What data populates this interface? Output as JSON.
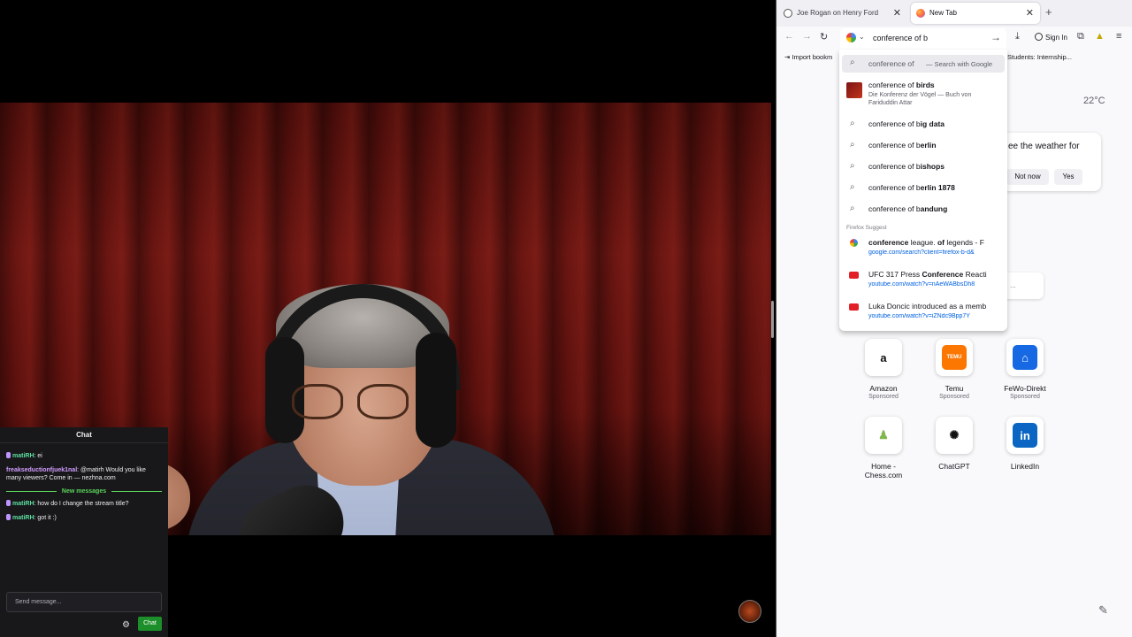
{
  "chat": {
    "title": "Chat",
    "messages": [
      {
        "user": "matiRH",
        "sep": ": ",
        "text": "ei",
        "color": "green"
      },
      {
        "user": "freakseductionfjuek1nal",
        "sep": ": ",
        "text": "@matirh Would you like many viewers? Come in — nezhna.com",
        "color": "purple"
      }
    ],
    "new_messages_label": "New messages",
    "messages_after": [
      {
        "user": "matiRH",
        "sep": ": ",
        "text": "how do I change the stream title?"
      },
      {
        "user": "matiRH",
        "sep": ": ",
        "text": "got it :)"
      }
    ],
    "input_placeholder": "Send message...",
    "send_label": "Chat"
  },
  "browser": {
    "tabs": [
      {
        "title": "Joe Rogan on Henry Ford",
        "active": false
      },
      {
        "title": "New Tab",
        "active": true
      }
    ],
    "new_tab_icon": "+",
    "urlbar": {
      "value": "conference of b",
      "engine_icon": "google-icon"
    },
    "signin_label": "Sign In",
    "bookmarks": [
      {
        "label": "Import bookm"
      },
      {
        "label": "Students: Internship..."
      }
    ],
    "suggestions": {
      "selected": {
        "text": "conference of",
        "action": "Search with Google"
      },
      "rich": {
        "prefix": "conference of ",
        "bold": "birds",
        "sub": "Die Konferenz der Vögel — Buch von Fariduddin Attar"
      },
      "searches": [
        {
          "prefix": "conference of b",
          "bold": "ig data"
        },
        {
          "prefix": "conference of b",
          "bold": "erlin"
        },
        {
          "prefix": "conference of b",
          "bold": "ishops"
        },
        {
          "prefix": "conference of b",
          "bold": "erlin 1878"
        },
        {
          "prefix": "conference of b",
          "bold": "andung"
        }
      ],
      "section_label": "Firefox Suggest",
      "history": [
        {
          "icon": "google-icon",
          "bold1": "conference",
          "mid1": " league. ",
          "bold2": "of",
          "rest": " legends - F",
          "url": "google.com/search?client=firefox-b-d&"
        },
        {
          "icon": "youtube-icon",
          "pre": "UFC 317 Press ",
          "bold1": "Conference",
          "rest": " Reacti",
          "url": "youtube.com/watch?v=nAeWABbsDh8"
        },
        {
          "icon": "youtube-icon",
          "pre": "Luka Doncic introduced as a memb",
          "url": "youtube.com/watch?v=iZNdc9Bpp7Y"
        }
      ]
    },
    "weather": {
      "temp": "22°C",
      "question": "ee the weather for",
      "no": "Not now",
      "yes": "Yes"
    },
    "hidden_card_text": "...",
    "shortcuts": [
      {
        "label": "Amazon",
        "sub": "Sponsored",
        "glyph": "a",
        "bg": "#ffffff",
        "fg": "#111111"
      },
      {
        "label": "Temu",
        "sub": "Sponsored",
        "glyph": "TEMU",
        "bg": "#fb7701",
        "fg": "#ffffff"
      },
      {
        "label": "FeWo-Direkt",
        "sub": "Sponsored",
        "glyph": "⌂",
        "bg": "#1668e3",
        "fg": "#ffffff"
      },
      {
        "label": "Home -\nChess.com",
        "sub": "",
        "glyph": "♟",
        "bg": "#ffffff",
        "fg": "#81b64c"
      },
      {
        "label": "ChatGPT",
        "sub": "",
        "glyph": "✺",
        "bg": "#ffffff",
        "fg": "#111111"
      },
      {
        "label": "LinkedIn",
        "sub": "",
        "glyph": "in",
        "bg": "#0a66c2",
        "fg": "#ffffff"
      }
    ]
  }
}
